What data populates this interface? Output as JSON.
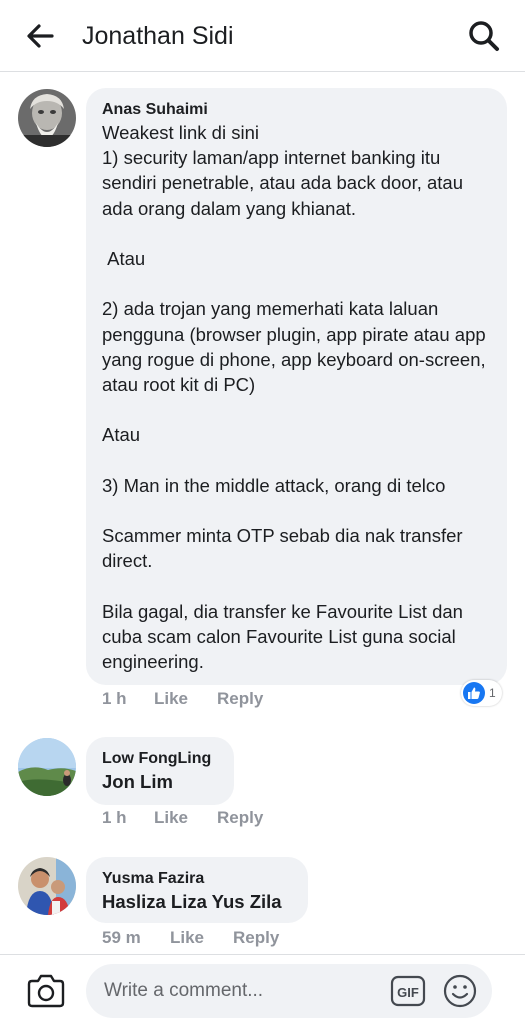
{
  "header": {
    "title": "Jonathan Sidi"
  },
  "comments": [
    {
      "author": "Anas Suhaimi",
      "text": "Weakest link di sini\n1) security laman/app internet banking itu sendiri penetrable, atau ada back door, atau ada orang dalam yang khianat.\n\n Atau\n\n2) ada trojan yang memerhati kata laluan pengguna (browser plugin, app pirate atau app yang rogue di phone, app keyboard on-screen, atau root kit di PC)\n\nAtau\n\n3) Man in the middle attack, orang di telco\n\nScammer minta OTP sebab dia nak transfer direct.\n\nBila gagal, dia transfer ke Favourite List dan cuba scam calon Favourite List guna social engineering.",
      "time": "1 h",
      "like_label": "Like",
      "reply_label": "Reply",
      "reaction_count": "1"
    },
    {
      "author": "Low FongLing",
      "text": "Jon Lim",
      "time": "1 h",
      "like_label": "Like",
      "reply_label": "Reply"
    },
    {
      "author": "Yusma Fazira",
      "text": "Hasliza Liza Yus Zila",
      "time": "59 m",
      "like_label": "Like",
      "reply_label": "Reply"
    }
  ],
  "composer": {
    "placeholder": "Write a comment..."
  },
  "colors": {
    "accent": "#1877f2",
    "bubble": "#f0f2f5",
    "meta": "#90949c"
  },
  "icons": [
    "back-arrow-icon",
    "search-icon",
    "like-icon",
    "camera-icon",
    "gif-icon",
    "emoji-icon"
  ]
}
